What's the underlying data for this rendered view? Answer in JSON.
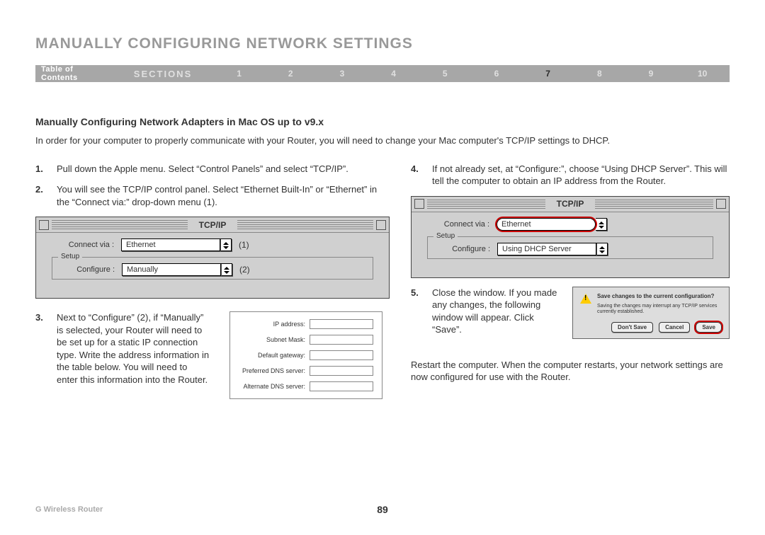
{
  "header": {
    "title": "Manually Configuring Network Settings"
  },
  "nav": {
    "toc": "Table of Contents",
    "sections_label": "SECTIONS",
    "items": [
      "1",
      "2",
      "3",
      "4",
      "5",
      "6",
      "7",
      "8",
      "9",
      "10"
    ],
    "active_index": 6
  },
  "subheading": "Manually Configuring Network Adapters in Mac OS up to v9.x",
  "intro": "In order for your computer to properly communicate with your Router, you will need to change your Mac computer's TCP/IP settings to DHCP.",
  "left_steps": {
    "s1": {
      "num": "1.",
      "text": "Pull down the Apple menu. Select “Control Panels” and select “TCP/IP”."
    },
    "s2": {
      "num": "2.",
      "text": "You will see the TCP/IP control panel. Select “Ethernet Built-In” or “Ethernet” in the “Connect via:” drop-down menu (1)."
    },
    "s3": {
      "num": "3.",
      "text": "Next to “Configure” (2), if “Manually” is selected, your Router will need to be set up for a static IP connection type. Write the address information in the table below. You will need to enter this information into the Router."
    }
  },
  "right_steps": {
    "s4": {
      "num": "4.",
      "text": "If not already set, at “Configure:”, choose “Using DHCP Server”. This will tell the computer to obtain an IP address from the Router."
    },
    "s5": {
      "num": "5.",
      "text": "Close the window. If you made any changes, the following window will appear. Click “Save”."
    },
    "restart": "Restart the computer. When the computer restarts, your network settings are now configured for use with the Router."
  },
  "tcpip_window1": {
    "title": "TCP/IP",
    "connect_label": "Connect via :",
    "connect_value": "Ethernet",
    "callout1": "(1)",
    "setup_legend": "Setup",
    "configure_label": "Configure :",
    "configure_value": "Manually",
    "callout2": "(2)"
  },
  "tcpip_window2": {
    "title": "TCP/IP",
    "connect_label": "Connect via :",
    "connect_value": "Ethernet",
    "setup_legend": "Setup",
    "configure_label": "Configure :",
    "configure_value": "Using DHCP Server"
  },
  "ip_fields": {
    "r1": "IP address:",
    "r2": "Subnet Mask:",
    "r3": "Default gateway:",
    "r4": "Preferred DNS server:",
    "r5": "Alternate DNS server:"
  },
  "save_dialog": {
    "heading": "Save changes to the current configuration?",
    "sub": "Saving the changes may interrupt any TCP/IP services currently established.",
    "dont_save": "Don't Save",
    "cancel": "Cancel",
    "save": "Save"
  },
  "footer": {
    "product": "G Wireless Router",
    "page": "89"
  }
}
